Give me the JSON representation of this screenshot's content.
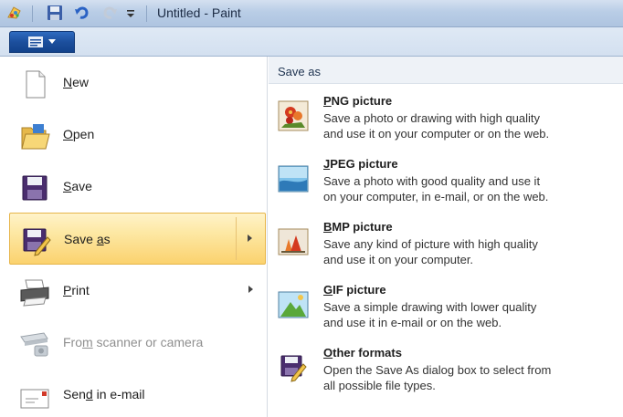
{
  "window": {
    "title": "Untitled - Paint"
  },
  "menu": {
    "items": [
      {
        "label_prefix": "",
        "label_underlined": "N",
        "label_suffix": "ew",
        "icon": "new-document-icon"
      },
      {
        "label_prefix": "",
        "label_underlined": "O",
        "label_suffix": "pen",
        "icon": "open-folder-icon"
      },
      {
        "label_prefix": "",
        "label_underlined": "S",
        "label_suffix": "ave",
        "icon": "save-disk-icon"
      },
      {
        "label_prefix": "Save ",
        "label_underlined": "a",
        "label_suffix": "s",
        "icon": "save-as-icon"
      },
      {
        "label_prefix": "",
        "label_underlined": "P",
        "label_suffix": "rint",
        "icon": "printer-icon"
      },
      {
        "label_prefix": "Fro",
        "label_underlined": "m",
        "label_suffix": " scanner or camera",
        "icon": "scanner-camera-icon"
      },
      {
        "label_prefix": "Sen",
        "label_underlined": "d",
        "label_suffix": " in e-mail",
        "icon": "email-icon"
      }
    ]
  },
  "save_as": {
    "header": "Save as",
    "options": [
      {
        "title_underlined": "P",
        "title_rest": "NG picture",
        "desc_line1": "Save a photo or drawing with high quality",
        "desc_line2": "and use it on your computer or on the web.",
        "icon": "png-picture-icon"
      },
      {
        "title_underlined": "J",
        "title_rest": "PEG picture",
        "desc_line1": "Save a photo with good quality and use it",
        "desc_line2": "on your computer, in e-mail, or on the web.",
        "icon": "jpeg-picture-icon"
      },
      {
        "title_underlined": "B",
        "title_rest": "MP picture",
        "desc_line1": "Save any kind of picture with high quality",
        "desc_line2": "and use it on your computer.",
        "icon": "bmp-picture-icon"
      },
      {
        "title_underlined": "G",
        "title_rest": "IF picture",
        "desc_line1": "Save a simple drawing with lower quality",
        "desc_line2": "and use it in e-mail or on the web.",
        "icon": "gif-picture-icon"
      },
      {
        "title_underlined": "O",
        "title_rest": "ther formats",
        "desc_line1": "Open the Save As dialog box to select from",
        "desc_line2": "all possible file types.",
        "icon": "other-formats-icon"
      }
    ]
  }
}
